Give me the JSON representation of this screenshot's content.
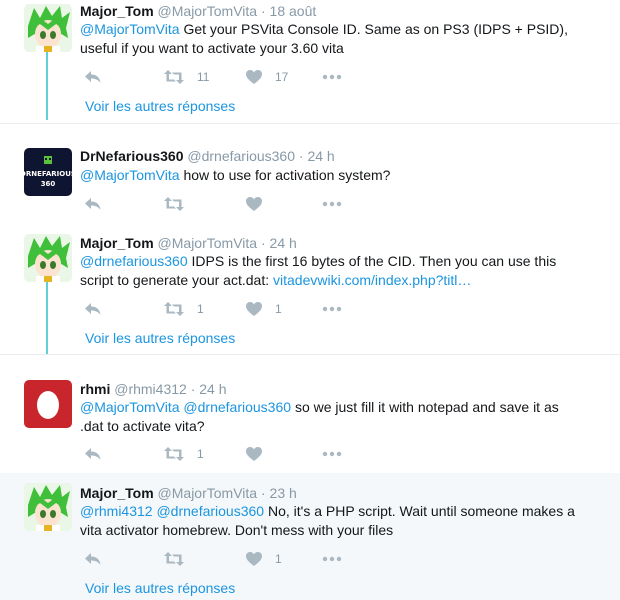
{
  "tweets": [
    {
      "name": "Major_Tom",
      "handle": "@MajorTomVita",
      "dot": "·",
      "time": "18 août",
      "mentions": "@MajorTomVita",
      "text": "Get your PSVita Console ID. Same as on PS3 (IDPS + PSID), useful if you want to activate your 3.60 vita",
      "retweets": "11",
      "likes": "17"
    },
    {
      "name": "DrNefarious360",
      "handle": "@drnefarious360",
      "dot": "·",
      "time": "24 h",
      "avatar_text": "DRNEFARIOUS 360",
      "mentions": "@MajorTomVita",
      "text": "how to use for activation system?",
      "retweets": "",
      "likes": ""
    },
    {
      "name": "Major_Tom",
      "handle": "@MajorTomVita",
      "dot": "·",
      "time": "24 h",
      "mentions": "@drnefarious360",
      "text": "IDPS is the first 16 bytes of the CID. Then you can use this script to generate your act.dat:",
      "link": "vitadevwiki.com/index.php?titl…",
      "retweets": "1",
      "likes": "1"
    },
    {
      "name": "rhmi",
      "handle": "@rhmi4312",
      "dot": "·",
      "time": "24 h",
      "mentions": "@MajorTomVita @drnefarious360",
      "text": "so we just fill it with notepad and save it as .dat to activate vita?",
      "retweets": "1",
      "likes": ""
    },
    {
      "name": "Major_Tom",
      "handle": "@MajorTomVita",
      "dot": "·",
      "time": "23 h",
      "mentions": "@rhmi4312 @drnefarious360",
      "text": "No, it's a PHP script. Wait until someone makes a vita activator homebrew. Don't mess with your files",
      "retweets": "",
      "likes": "1"
    }
  ],
  "more_replies_label": "Voir les autres réponses",
  "icons": [
    "reply-icon",
    "retweet-icon",
    "like-icon",
    "more-icon"
  ],
  "colors": {
    "accent": "#1b95e0",
    "muted": "#8899a6",
    "thread": "#5fcfd8",
    "highlight": "#f5f8fa",
    "rhmi_avatar": "#c9252c"
  }
}
